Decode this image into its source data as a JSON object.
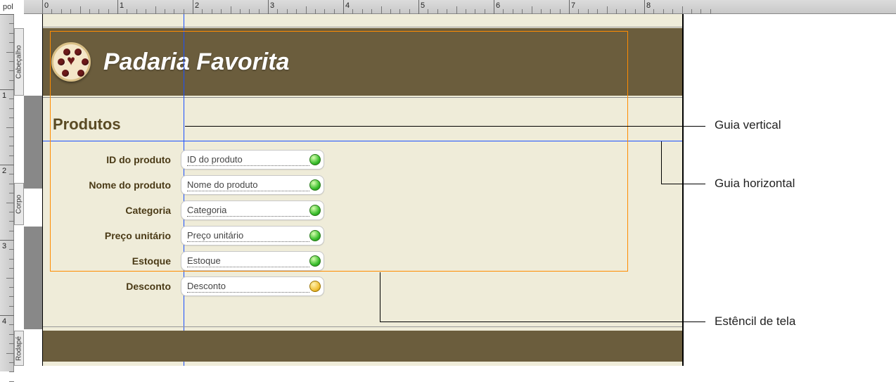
{
  "ruler": {
    "unit": "pol"
  },
  "sections": {
    "header": "Cabeçalho",
    "body": "Corpo",
    "footer": "Rodapé"
  },
  "header": {
    "title": "Padaria Favorita"
  },
  "section_title": "Produtos",
  "fields": [
    {
      "label": "ID do produto",
      "placeholder": "ID do produto",
      "status": "ok"
    },
    {
      "label": "Nome do produto",
      "placeholder": "Nome do produto",
      "status": "ok"
    },
    {
      "label": "Categoria",
      "placeholder": "Categoria",
      "status": "ok"
    },
    {
      "label": "Preço unitário",
      "placeholder": "Preço unitário",
      "status": "ok"
    },
    {
      "label": "Estoque",
      "placeholder": "Estoque",
      "status": "ok"
    },
    {
      "label": "Desconto",
      "placeholder": "Desconto",
      "status": "warn"
    }
  ],
  "callouts": {
    "vertical": "Guia vertical",
    "horizontal": "Guia horizontal",
    "stencil": "Estêncil de tela"
  },
  "ruler_numbers": [
    "0",
    "1",
    "2",
    "3",
    "4",
    "5",
    "6",
    "7",
    "8"
  ]
}
